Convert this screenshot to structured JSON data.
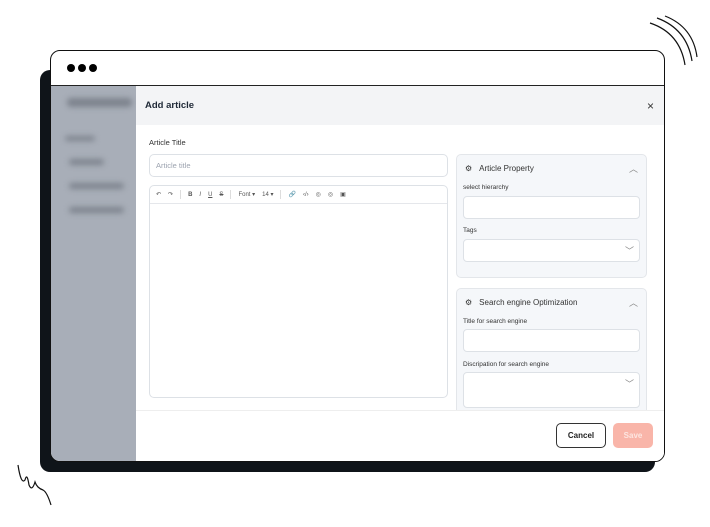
{
  "modal": {
    "title": "Add article",
    "close": "×"
  },
  "form": {
    "article_title_label": "Article Title",
    "article_title_placeholder": "Article title",
    "toolbar": {
      "undo": "↶",
      "redo": "↷",
      "bold": "B",
      "italic": "I",
      "underline": "U",
      "strike": "S",
      "font": "Font ▾",
      "size": "14 ▾",
      "link": "🔗",
      "code": "‹/›",
      "emoji1": "◎",
      "emoji2": "◎",
      "image": "▣"
    }
  },
  "article_property": {
    "title": "Article Property",
    "hierarchy_label": "select hierarchy",
    "tags_label": "Tags"
  },
  "seo": {
    "title": "Search engine Optimization",
    "title_label": "Title for search engine",
    "description_label": "Discripation for search engine"
  },
  "footer": {
    "cancel": "Cancel",
    "save": "Save"
  },
  "colors": {
    "save_disabled": "#f9b5a9",
    "header_bg": "#f3f4f6"
  }
}
